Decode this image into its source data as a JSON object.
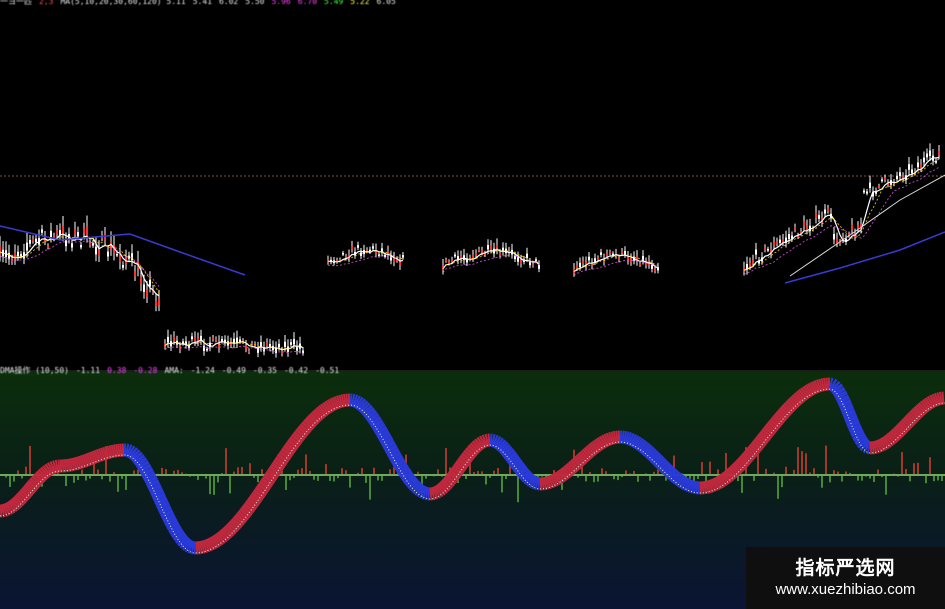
{
  "price_chart": {
    "info_bar": [
      {
        "text": "一ヨ一匹",
        "color": "#e6e6e6"
      },
      {
        "text": "2,3",
        "color": "#ff5050"
      },
      {
        "text": "MA(5,10,20,30,60,120) 5.11",
        "color": "#e6e6e6"
      },
      {
        "text": "5.41",
        "color": "#e6e6e6"
      },
      {
        "text": "6.02",
        "color": "#e6e6e6"
      },
      {
        "text": "5.50",
        "color": "#e6e6e6"
      },
      {
        "text": "5.96",
        "color": "#ff40ff"
      },
      {
        "text": "6.70",
        "color": "#ff40ff"
      },
      {
        "text": "5.49",
        "color": "#40ff40"
      },
      {
        "text": "5.22",
        "color": "#ffff40"
      },
      {
        "text": "6.05",
        "color": "#e6e6e6"
      }
    ],
    "colors": {
      "candles": "#ffffff",
      "ma_short": "#ffd700",
      "ma_mid": "#ff66ff",
      "ma_long": "#3a3ad0",
      "ref_line": "#a0705a"
    }
  },
  "indicator": {
    "info_bar": [
      {
        "text": "DMA操作 (10,50)",
        "color": "#e6e6e6"
      },
      {
        "text": "-1.11",
        "color": "#e6e6e6"
      },
      {
        "text": "0.38",
        "color": "#ff40ff"
      },
      {
        "text": "-0.28",
        "color": "#ff40ff"
      },
      {
        "text": "AMA:",
        "color": "#e6e6e6"
      },
      {
        "text": "-1.24",
        "color": "#e6e6e6"
      },
      {
        "text": "-0.49",
        "color": "#e6e6e6"
      },
      {
        "text": "-0.35",
        "color": "#e6e6e6"
      },
      {
        "text": "-0.42",
        "color": "#e6e6e6"
      },
      {
        "text": "-0.51",
        "color": "#e6e6e6"
      }
    ],
    "colors": {
      "background_top": "#0b2e0b",
      "background_bottom": "#0a1434",
      "rising": "#c0283e",
      "falling": "#2a3ad8",
      "zero_line": "#6fa85e",
      "bar_up": "#d44030",
      "bar_down": "#5caa3c"
    }
  },
  "watermark": {
    "title": "指标严选网",
    "url": "www.xuezhibiao.com"
  }
}
